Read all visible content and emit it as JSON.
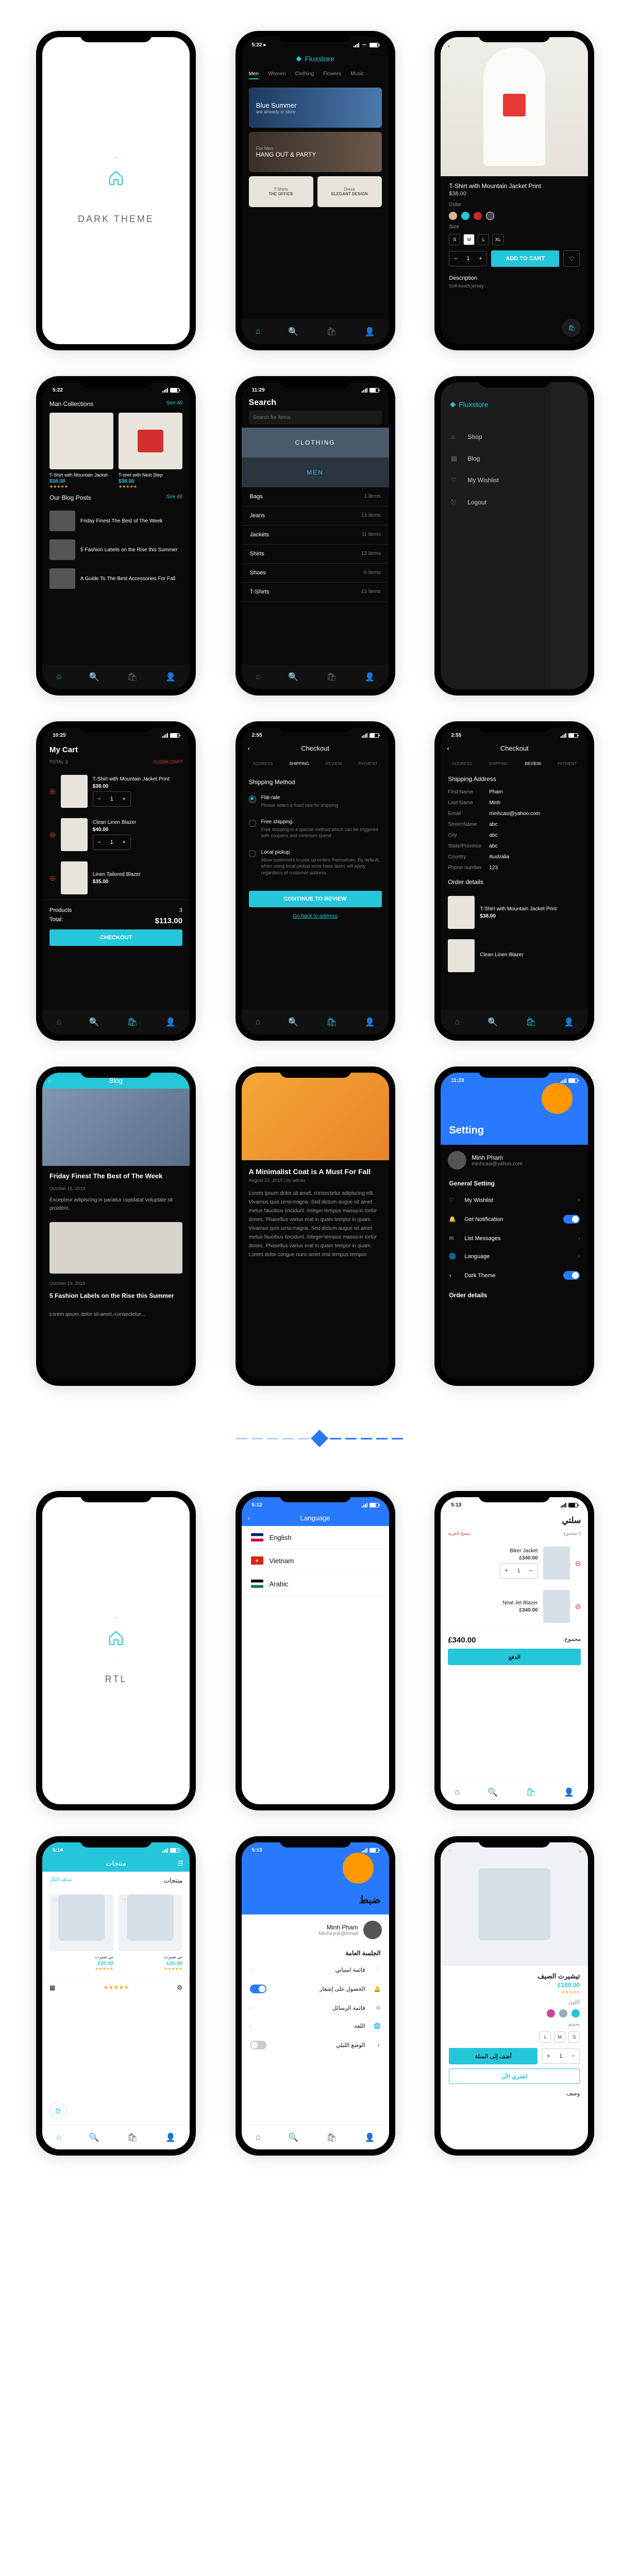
{
  "splash": {
    "dark": "DARK THEME",
    "rtl": "RTL"
  },
  "home": {
    "time": "5:22 ▸",
    "brand": "Fluxstore",
    "tabs": [
      "Men",
      "Women",
      "Clothing",
      "Flowers",
      "Music"
    ],
    "b1a": "Blue Summer",
    "b1b": "are already in store",
    "b2a": "For Men",
    "b2b": "HANG OUT & PARTY",
    "c1a": "T-Shirts",
    "c1b": "THE OFFICE",
    "c2a": "Dress",
    "c2b": "ELEGANT DESIGN"
  },
  "product": {
    "title": "T-Shirt with Mountain Jacket Print",
    "price": "$38.00",
    "color": "Color",
    "size": "Size",
    "sizes": [
      "S",
      "M",
      "L",
      "XL"
    ],
    "qty": "1",
    "add": "ADD TO CART",
    "desc": "Description",
    "desc_sub": "Soft-touch jersey"
  },
  "collections": {
    "title": "Man Collections",
    "see": "See All",
    "p1": "T-Shirt with Mountain Jacket",
    "p1p": "$38.00",
    "p2": "T-shirt with Next Step",
    "p2p": "$38.00",
    "blog": "Our Blog Posts",
    "b1": "Friday Finest The Best of The Week",
    "b2": "5 Fashion Labels on the Rise this Summer",
    "b3": "A Guide To The Best Accessories For Fall"
  },
  "search": {
    "time": "11:29",
    "title": "Search",
    "ph": "Search for items",
    "c1": "CLOTHING",
    "c2": "MEN",
    "r1": "Bags",
    "r1c": "1 items",
    "r2": "Jeans",
    "r2c": "13 items",
    "r3": "Jackets",
    "r3c": "11 items",
    "r4": "Shirts",
    "r4c": "13 items",
    "r5": "Shoes",
    "r5c": "6 items",
    "r6": "T-Shirts",
    "r6c": "13 items"
  },
  "drawer": {
    "shop": "Shop",
    "blog": "Blog",
    "wish": "My Wishlist",
    "logout": "Logout"
  },
  "cart": {
    "time": "10:25",
    "title": "My Cart",
    "total_lbl": "TOTAL",
    "clear": "CLEAR CART",
    "i1": "T-Shirt with Mountain Jacket Print",
    "i1p": "$38.00",
    "i2": "Clean Linen Blazer",
    "i2p": "$40.00",
    "i3": "Linen Tailored Blazer",
    "i3p": "$35.00",
    "prod": "Products",
    "prodc": "3",
    "tot": "Total:",
    "totv": "$113.00",
    "chk": "CHECKOUT"
  },
  "ship": {
    "time": "2:55",
    "title": "Checkout",
    "s1": "ADDRESS",
    "s2": "SHIPPING",
    "s3": "REVIEW",
    "s4": "PAYMENT",
    "hd": "Shipping Method",
    "flat": "Flat rate",
    "flat_s": "Please select a fixed rate for shipping",
    "free": "Free shipping",
    "free_s": "Free shipping is a special method which can be triggered with coupons and minimum spend.",
    "local": "Local pickup",
    "local_s": "Allow customers to pick up orders themselves. By default, when using local pickup store base taxes will apply regardless of customer address.",
    "cont": "CONTINUE TO REVIEW",
    "back": "Go back to address"
  },
  "addr": {
    "hd": "Shipping Address",
    "f1": "First Name",
    "v1": "Pham",
    "f2": "Last Name",
    "v2": "Minh",
    "f3": "Email",
    "v3": "minhcasi@yahoo.com",
    "f4": "Street Name",
    "v4": "abc",
    "f5": "City",
    "v5": "abc",
    "f6": "State/Province",
    "v6": "abc",
    "f7": "Country",
    "v7": "Australia",
    "f8": "Phone number",
    "v8": "123",
    "ord": "Order details"
  },
  "bloghdr": {
    "title": "Blog",
    "post": "Friday Finest The Best of The Week",
    "meta": "October 19, 2019",
    "excerpt": "Excepteur adipiscing in pariatur cupidatat voluptate sit proident,",
    "p2": "5 Fashion Labels on the Rise this Summer",
    "loremsm": "Lorem ipsum dolor sit amet, consectetur..."
  },
  "article": {
    "title": "A Minimalist Coat is A Must For Fall",
    "meta": "August 21, 2019 | by admin",
    "lorem": "Lorem ipsum dolor sit amet, consectetur adipiscing elit. Vivamus quis urna magna. Sed dictum augue sit amet metus faucibus tincidunt. Integer tempus massa in tortor donec. Phasellus varius erat in quam tempor in quam. Vivamus quis urna magna. Sed dictum augue sit amet metus faucibus tincidunt. Integer tempus massa in tortor donec. Phasellus varius erat in quam tempor in quam. Lorem dolor congue nunc amet erat tempus tempor."
  },
  "settings": {
    "time": "11:23",
    "title": "Setting",
    "name": "Minh Pham",
    "email": "minhcasi@yahoo.com",
    "gen": "General Setting",
    "wish": "My Wishlist",
    "notif": "Get Notification",
    "msg": "List Messages",
    "lang": "Language",
    "dark": "Dark Theme",
    "ord": "Order details"
  },
  "language": {
    "time": "5:12",
    "title": "Language",
    "en": "English",
    "vn": "Vietnam",
    "ar": "Arabic"
  },
  "rtl_cart": {
    "title": "سلتي",
    "clear": "مسح العربة",
    "totlbl": "مجموع",
    "itemc": "3",
    "i1": "Biker Jacket",
    "i1p": "£340.00",
    "i2": "Neat Jet Blazer",
    "i2p": "£340.00",
    "tot": "مجموع:",
    "totv": "£340.00",
    "chk": "الدفع"
  },
  "rtl_prods": {
    "time": "5:14",
    "title": "منتجات",
    "p": "تي شيرت",
    "pp": "£20.00",
    "see": "شاهد الكل"
  },
  "rtl_set": {
    "time": "5:13",
    "title": "ضبط",
    "name": "Minh Pham",
    "email": "Minhxynk@email",
    "gen": "الجلسة العامة",
    "wish": "قائمة امنياتي",
    "notif": "الحصول على إشعار",
    "msg": "قائمة الرسائل",
    "lang": "اللغة",
    "dark": "الوضع الليلي"
  },
  "rtl_prod": {
    "title": "تيشيرت الصيف",
    "price": "£160.00",
    "color": "اللون",
    "size": "بحجم",
    "add": "أضف إلى السلة",
    "desc": "وصف"
  }
}
